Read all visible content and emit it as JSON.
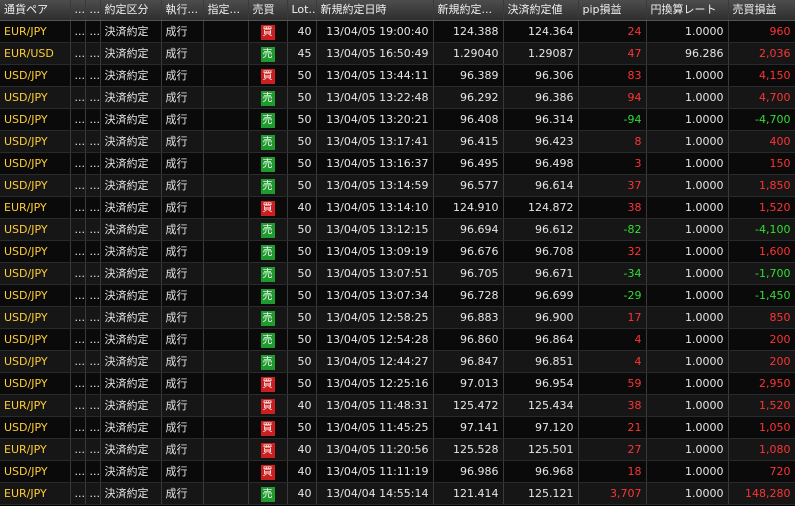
{
  "columns": [
    "通貨ペア",
    "...",
    "...",
    "約定区分",
    "執行...",
    "指定...",
    "売買",
    "Lot...",
    "新規約定日時",
    "新規約定...",
    "決済約定値",
    "pip損益",
    "円換算レート",
    "売買損益"
  ],
  "colors": {
    "buy": "#cc1f1f",
    "sell": "#1e9a2e",
    "profit": "#ff3333",
    "loss": "#33dd33",
    "pair": "#ffcc33"
  },
  "rows": [
    {
      "pair": "EUR/JPY",
      "c2": "...",
      "c3": "...",
      "kubun": "決済約定",
      "shikko": "成行",
      "shitei": "",
      "side": "買",
      "side_type": "buy",
      "lot": "40",
      "datetime": "13/04/05 19:00:40",
      "open": "124.388",
      "close": "124.364",
      "pip": "24",
      "pip_sign": "pos",
      "rate": "1.0000",
      "pnl": "960",
      "pnl_sign": "pos"
    },
    {
      "pair": "EUR/USD",
      "c2": "...",
      "c3": "...",
      "kubun": "決済約定",
      "shikko": "成行",
      "shitei": "",
      "side": "売",
      "side_type": "sell",
      "lot": "45",
      "datetime": "13/04/05 16:50:49",
      "open": "1.29040",
      "close": "1.29087",
      "pip": "47",
      "pip_sign": "pos",
      "rate": "96.286",
      "pnl": "2,036",
      "pnl_sign": "pos"
    },
    {
      "pair": "USD/JPY",
      "c2": "...",
      "c3": "...",
      "kubun": "決済約定",
      "shikko": "成行",
      "shitei": "",
      "side": "買",
      "side_type": "buy",
      "lot": "50",
      "datetime": "13/04/05 13:44:11",
      "open": "96.389",
      "close": "96.306",
      "pip": "83",
      "pip_sign": "pos",
      "rate": "1.0000",
      "pnl": "4,150",
      "pnl_sign": "pos"
    },
    {
      "pair": "USD/JPY",
      "c2": "...",
      "c3": "...",
      "kubun": "決済約定",
      "shikko": "成行",
      "shitei": "",
      "side": "売",
      "side_type": "sell",
      "lot": "50",
      "datetime": "13/04/05 13:22:48",
      "open": "96.292",
      "close": "96.386",
      "pip": "94",
      "pip_sign": "pos",
      "rate": "1.0000",
      "pnl": "4,700",
      "pnl_sign": "pos"
    },
    {
      "pair": "USD/JPY",
      "c2": "...",
      "c3": "...",
      "kubun": "決済約定",
      "shikko": "成行",
      "shitei": "",
      "side": "売",
      "side_type": "sell",
      "lot": "50",
      "datetime": "13/04/05 13:20:21",
      "open": "96.408",
      "close": "96.314",
      "pip": "-94",
      "pip_sign": "neg",
      "rate": "1.0000",
      "pnl": "-4,700",
      "pnl_sign": "neg"
    },
    {
      "pair": "USD/JPY",
      "c2": "...",
      "c3": "...",
      "kubun": "決済約定",
      "shikko": "成行",
      "shitei": "",
      "side": "売",
      "side_type": "sell",
      "lot": "50",
      "datetime": "13/04/05 13:17:41",
      "open": "96.415",
      "close": "96.423",
      "pip": "8",
      "pip_sign": "pos",
      "rate": "1.0000",
      "pnl": "400",
      "pnl_sign": "pos"
    },
    {
      "pair": "USD/JPY",
      "c2": "...",
      "c3": "...",
      "kubun": "決済約定",
      "shikko": "成行",
      "shitei": "",
      "side": "売",
      "side_type": "sell",
      "lot": "50",
      "datetime": "13/04/05 13:16:37",
      "open": "96.495",
      "close": "96.498",
      "pip": "3",
      "pip_sign": "pos",
      "rate": "1.0000",
      "pnl": "150",
      "pnl_sign": "pos"
    },
    {
      "pair": "USD/JPY",
      "c2": "...",
      "c3": "...",
      "kubun": "決済約定",
      "shikko": "成行",
      "shitei": "",
      "side": "売",
      "side_type": "sell",
      "lot": "50",
      "datetime": "13/04/05 13:14:59",
      "open": "96.577",
      "close": "96.614",
      "pip": "37",
      "pip_sign": "pos",
      "rate": "1.0000",
      "pnl": "1,850",
      "pnl_sign": "pos"
    },
    {
      "pair": "EUR/JPY",
      "c2": "...",
      "c3": "...",
      "kubun": "決済約定",
      "shikko": "成行",
      "shitei": "",
      "side": "買",
      "side_type": "buy",
      "lot": "40",
      "datetime": "13/04/05 13:14:10",
      "open": "124.910",
      "close": "124.872",
      "pip": "38",
      "pip_sign": "pos",
      "rate": "1.0000",
      "pnl": "1,520",
      "pnl_sign": "pos"
    },
    {
      "pair": "USD/JPY",
      "c2": "...",
      "c3": "...",
      "kubun": "決済約定",
      "shikko": "成行",
      "shitei": "",
      "side": "売",
      "side_type": "sell",
      "lot": "50",
      "datetime": "13/04/05 13:12:15",
      "open": "96.694",
      "close": "96.612",
      "pip": "-82",
      "pip_sign": "neg",
      "rate": "1.0000",
      "pnl": "-4,100",
      "pnl_sign": "neg"
    },
    {
      "pair": "USD/JPY",
      "c2": "...",
      "c3": "...",
      "kubun": "決済約定",
      "shikko": "成行",
      "shitei": "",
      "side": "売",
      "side_type": "sell",
      "lot": "50",
      "datetime": "13/04/05 13:09:19",
      "open": "96.676",
      "close": "96.708",
      "pip": "32",
      "pip_sign": "pos",
      "rate": "1.0000",
      "pnl": "1,600",
      "pnl_sign": "pos"
    },
    {
      "pair": "USD/JPY",
      "c2": "...",
      "c3": "...",
      "kubun": "決済約定",
      "shikko": "成行",
      "shitei": "",
      "side": "売",
      "side_type": "sell",
      "lot": "50",
      "datetime": "13/04/05 13:07:51",
      "open": "96.705",
      "close": "96.671",
      "pip": "-34",
      "pip_sign": "neg",
      "rate": "1.0000",
      "pnl": "-1,700",
      "pnl_sign": "neg"
    },
    {
      "pair": "USD/JPY",
      "c2": "...",
      "c3": "...",
      "kubun": "決済約定",
      "shikko": "成行",
      "shitei": "",
      "side": "売",
      "side_type": "sell",
      "lot": "50",
      "datetime": "13/04/05 13:07:34",
      "open": "96.728",
      "close": "96.699",
      "pip": "-29",
      "pip_sign": "neg",
      "rate": "1.0000",
      "pnl": "-1,450",
      "pnl_sign": "neg"
    },
    {
      "pair": "USD/JPY",
      "c2": "...",
      "c3": "...",
      "kubun": "決済約定",
      "shikko": "成行",
      "shitei": "",
      "side": "売",
      "side_type": "sell",
      "lot": "50",
      "datetime": "13/04/05 12:58:25",
      "open": "96.883",
      "close": "96.900",
      "pip": "17",
      "pip_sign": "pos",
      "rate": "1.0000",
      "pnl": "850",
      "pnl_sign": "pos"
    },
    {
      "pair": "USD/JPY",
      "c2": "...",
      "c3": "...",
      "kubun": "決済約定",
      "shikko": "成行",
      "shitei": "",
      "side": "売",
      "side_type": "sell",
      "lot": "50",
      "datetime": "13/04/05 12:54:28",
      "open": "96.860",
      "close": "96.864",
      "pip": "4",
      "pip_sign": "pos",
      "rate": "1.0000",
      "pnl": "200",
      "pnl_sign": "pos"
    },
    {
      "pair": "USD/JPY",
      "c2": "...",
      "c3": "...",
      "kubun": "決済約定",
      "shikko": "成行",
      "shitei": "",
      "side": "売",
      "side_type": "sell",
      "lot": "50",
      "datetime": "13/04/05 12:44:27",
      "open": "96.847",
      "close": "96.851",
      "pip": "4",
      "pip_sign": "pos",
      "rate": "1.0000",
      "pnl": "200",
      "pnl_sign": "pos"
    },
    {
      "pair": "USD/JPY",
      "c2": "...",
      "c3": "...",
      "kubun": "決済約定",
      "shikko": "成行",
      "shitei": "",
      "side": "買",
      "side_type": "buy",
      "lot": "50",
      "datetime": "13/04/05 12:25:16",
      "open": "97.013",
      "close": "96.954",
      "pip": "59",
      "pip_sign": "pos",
      "rate": "1.0000",
      "pnl": "2,950",
      "pnl_sign": "pos"
    },
    {
      "pair": "EUR/JPY",
      "c2": "...",
      "c3": "...",
      "kubun": "決済約定",
      "shikko": "成行",
      "shitei": "",
      "side": "買",
      "side_type": "buy",
      "lot": "40",
      "datetime": "13/04/05 11:48:31",
      "open": "125.472",
      "close": "125.434",
      "pip": "38",
      "pip_sign": "pos",
      "rate": "1.0000",
      "pnl": "1,520",
      "pnl_sign": "pos"
    },
    {
      "pair": "USD/JPY",
      "c2": "...",
      "c3": "...",
      "kubun": "決済約定",
      "shikko": "成行",
      "shitei": "",
      "side": "買",
      "side_type": "buy",
      "lot": "50",
      "datetime": "13/04/05 11:45:25",
      "open": "97.141",
      "close": "97.120",
      "pip": "21",
      "pip_sign": "pos",
      "rate": "1.0000",
      "pnl": "1,050",
      "pnl_sign": "pos"
    },
    {
      "pair": "EUR/JPY",
      "c2": "...",
      "c3": "...",
      "kubun": "決済約定",
      "shikko": "成行",
      "shitei": "",
      "side": "買",
      "side_type": "buy",
      "lot": "40",
      "datetime": "13/04/05 11:20:56",
      "open": "125.528",
      "close": "125.501",
      "pip": "27",
      "pip_sign": "pos",
      "rate": "1.0000",
      "pnl": "1,080",
      "pnl_sign": "pos"
    },
    {
      "pair": "USD/JPY",
      "c2": "...",
      "c3": "...",
      "kubun": "決済約定",
      "shikko": "成行",
      "shitei": "",
      "side": "買",
      "side_type": "buy",
      "lot": "40",
      "datetime": "13/04/05 11:11:19",
      "open": "96.986",
      "close": "96.968",
      "pip": "18",
      "pip_sign": "pos",
      "rate": "1.0000",
      "pnl": "720",
      "pnl_sign": "pos"
    },
    {
      "pair": "EUR/JPY",
      "c2": "...",
      "c3": "...",
      "kubun": "決済約定",
      "shikko": "成行",
      "shitei": "",
      "side": "売",
      "side_type": "sell",
      "lot": "40",
      "datetime": "13/04/04 14:55:14",
      "open": "121.414",
      "close": "125.121",
      "pip": "3,707",
      "pip_sign": "pos",
      "rate": "1.0000",
      "pnl": "148,280",
      "pnl_sign": "pos"
    }
  ]
}
